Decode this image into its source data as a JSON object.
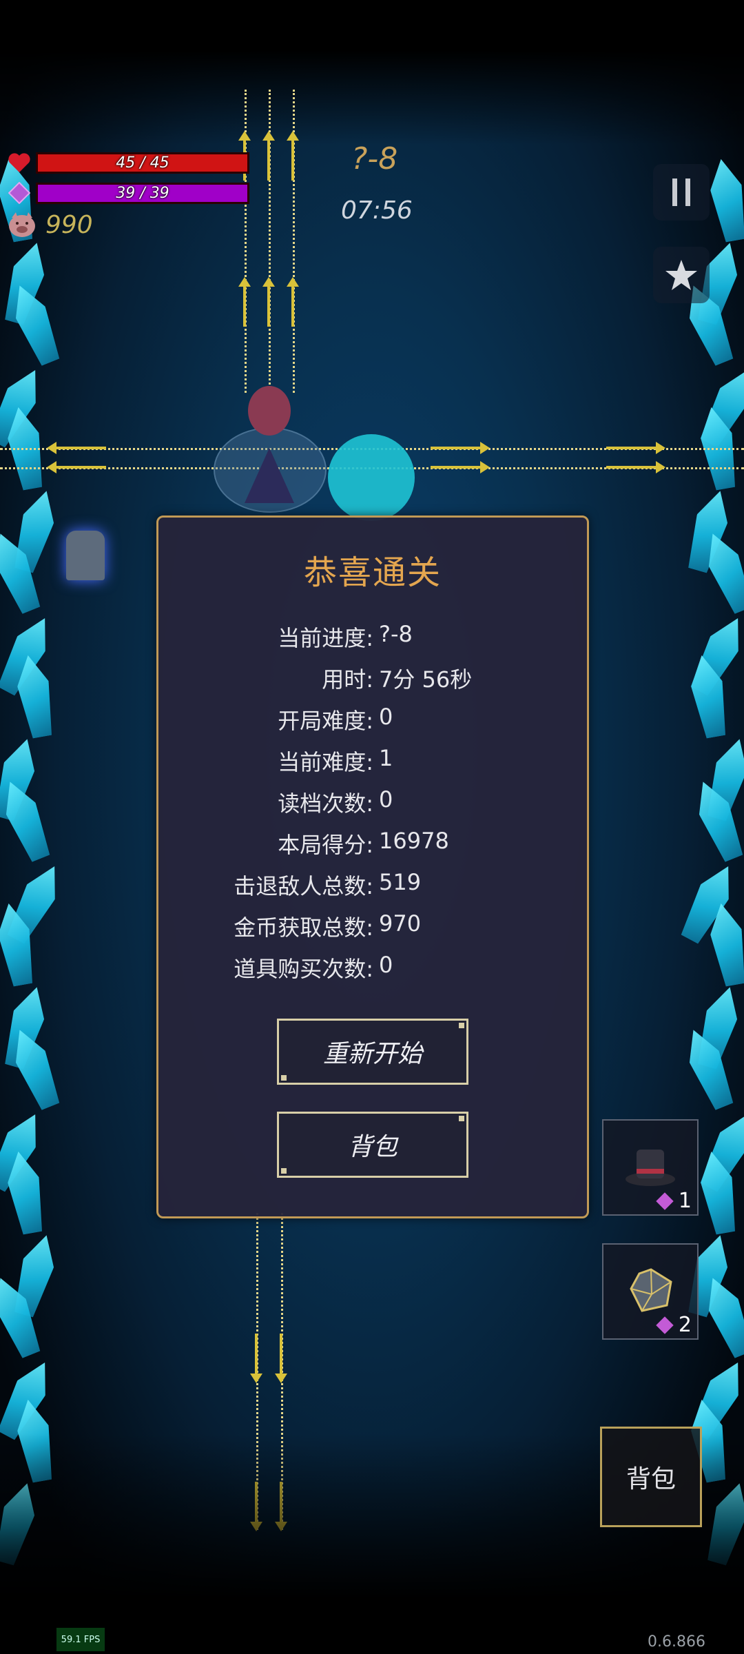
{
  "hud": {
    "hp": "45 / 45",
    "hp_fraction": 1.0,
    "mp": "39 / 39",
    "mp_fraction": 1.0,
    "coins": "990",
    "level": "?-8",
    "timer": "07:56",
    "colors": {
      "hp": "#d01414",
      "mp": "#a000c8",
      "accent": "#c9a25a"
    },
    "icons": {
      "hp": "heart-icon",
      "mp": "diamond-gem-icon",
      "coins": "pig-icon",
      "pause": "pause-icon",
      "favorite": "star-icon"
    }
  },
  "dialog": {
    "title": "恭喜通关",
    "stats": [
      {
        "label": "当前进度:",
        "value": "?-8"
      },
      {
        "label": "用时:",
        "value": "7分 56秒"
      },
      {
        "label": "开局难度:",
        "value": "0"
      },
      {
        "label": "当前难度:",
        "value": "1"
      },
      {
        "label": "读档次数:",
        "value": "0"
      },
      {
        "label": "本局得分:",
        "value": "16978"
      },
      {
        "label": "击退敌人总数:",
        "value": "519"
      },
      {
        "label": "金币获取总数:",
        "value": "970"
      },
      {
        "label": "道具购买次数:",
        "value": "0"
      }
    ],
    "restart_label": "重新开始",
    "bag_label": "背包"
  },
  "items": [
    {
      "icon": "top-hat-icon",
      "count": "1"
    },
    {
      "icon": "polyhedron-dice-icon",
      "count": "2"
    }
  ],
  "bag_button": "背包",
  "fps": "59.1 FPS",
  "version": "0.6.866"
}
